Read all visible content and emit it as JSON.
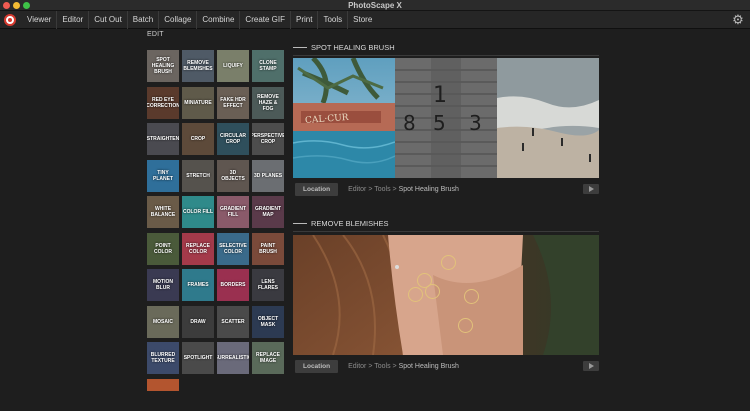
{
  "window": {
    "title": "PhotoScape X"
  },
  "menu": [
    "Viewer",
    "Editor",
    "Cut Out",
    "Batch",
    "Collage",
    "Combine",
    "Create GIF",
    "Print",
    "Tools",
    "Store"
  ],
  "sidebar": {
    "heading": "EDIT",
    "tools": [
      {
        "label": "SPOT HEALING BRUSH",
        "color": "#6b6560"
      },
      {
        "label": "REMOVE BLEMISHES",
        "color": "#4f5a66"
      },
      {
        "label": "LIQUIFY",
        "color": "#7a7f6a"
      },
      {
        "label": "CLONE STAMP",
        "color": "#4f6f6a"
      },
      {
        "label": "RED EYE CORRECTION",
        "color": "#5a3a2c"
      },
      {
        "label": "MINIATURE",
        "color": "#5f5a4a"
      },
      {
        "label": "FAKE HDR EFFECT",
        "color": "#6a5f55"
      },
      {
        "label": "REMOVE HAZE & FOG",
        "color": "#4c5a58"
      },
      {
        "label": "STRAIGHTEN",
        "color": "#4a4a50"
      },
      {
        "label": "CROP",
        "color": "#5d4a3a"
      },
      {
        "label": "CIRCULAR CROP",
        "color": "#2f4f5c"
      },
      {
        "label": "PERSPECTIVE CROP",
        "color": "#4d4d4d"
      },
      {
        "label": "TINY PLANET",
        "color": "#2f6f9a"
      },
      {
        "label": "STRETCH",
        "color": "#55524d"
      },
      {
        "label": "3D OBJECTS",
        "color": "#5f5650"
      },
      {
        "label": "3D PLANES",
        "color": "#6b6e72"
      },
      {
        "label": "WHITE BALANCE",
        "color": "#6a5b48"
      },
      {
        "label": "COLOR FILL",
        "color": "#2f8a8a"
      },
      {
        "label": "GRADIENT FILL",
        "color": "#8a5a6a"
      },
      {
        "label": "GRADIENT MAP",
        "color": "#5a3a4a"
      },
      {
        "label": "POINT COLOR",
        "color": "#4a5a3a"
      },
      {
        "label": "REPLACE COLOR",
        "color": "#a43a4a"
      },
      {
        "label": "SELECTIVE COLOR",
        "color": "#3a6a8a"
      },
      {
        "label": "PAINT BRUSH",
        "color": "#7a4a3a"
      },
      {
        "label": "MOTION BLUR",
        "color": "#3a3a52"
      },
      {
        "label": "FRAMES",
        "color": "#2f7a8c"
      },
      {
        "label": "BORDERS",
        "color": "#9a3050"
      },
      {
        "label": "LENS FLARES",
        "color": "#3a3a40"
      },
      {
        "label": "MOSAIC",
        "color": "#6a6a5a"
      },
      {
        "label": "DRAW",
        "color": "#3c3c3c"
      },
      {
        "label": "SCATTER",
        "color": "#4a4a4a"
      },
      {
        "label": "OBJECT MASK",
        "color": "#2c3a52"
      },
      {
        "label": "BLURRED TEXTURE",
        "color": "#3c4a6a"
      },
      {
        "label": "SPOTLIGHT",
        "color": "#4a4a4a"
      },
      {
        "label": "SURREALISTIC",
        "color": "#6a6a7a"
      },
      {
        "label": "REPLACE IMAGE",
        "color": "#5a6a5a"
      }
    ],
    "partial_tile_color": "#b3552f"
  },
  "sections": [
    {
      "title": "SPOT HEALING BRUSH",
      "location_label": "Location",
      "path_prefix": "Editor > Tools > ",
      "path_current": "Spot Healing Brush"
    },
    {
      "title": "REMOVE BLEMISHES",
      "location_label": "Location",
      "path_prefix": "Editor > Tools > ",
      "path_current": "Spot Healing Brush"
    }
  ],
  "icons": {
    "logo": "photoscape-logo",
    "settings": "gear-icon",
    "play": "play-icon"
  }
}
